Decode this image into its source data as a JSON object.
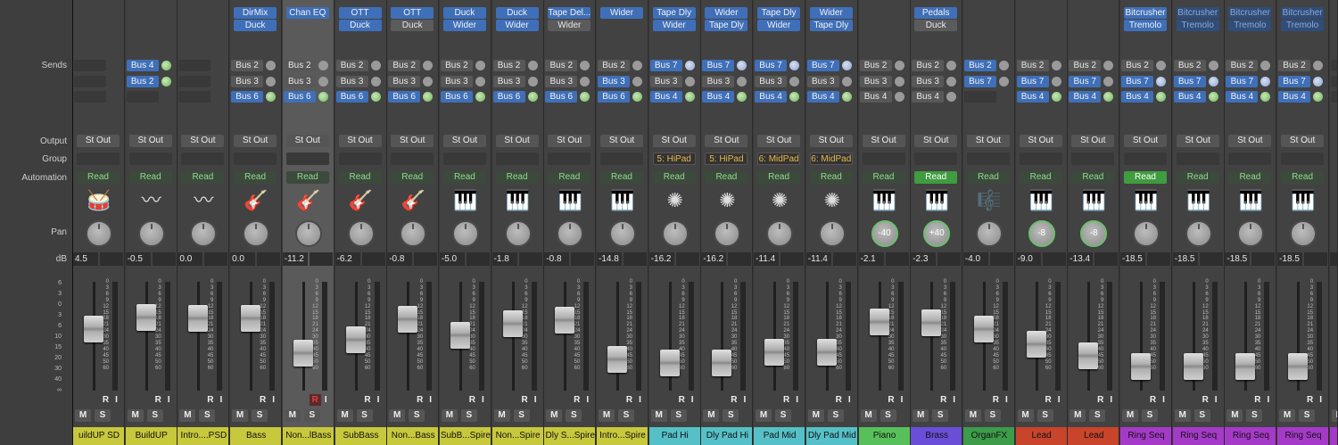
{
  "row_labels": {
    "sends": "Sends",
    "output": "Output",
    "group": "Group",
    "automation": "Automation",
    "pan": "Pan",
    "db": "dB"
  },
  "fader_scale": [
    "0",
    "3",
    "6",
    "9",
    "12",
    "15",
    "18",
    "21",
    "24",
    "30",
    "35",
    "40",
    "45",
    "50",
    "60"
  ],
  "left_scale": [
    "6",
    "3",
    "0",
    "3",
    "6",
    "10",
    "15",
    "20",
    "30",
    "40",
    "∞"
  ],
  "buttons": {
    "r": "R",
    "i": "I",
    "m": "M",
    "s": "S"
  },
  "colors": {
    "yellow": "#c8c83c",
    "cyan": "#56c0c8",
    "green": "#58c05a",
    "purple": "#6a4ed8",
    "dgreen": "#3c9c4a",
    "red": "#c8442a",
    "violet": "#a63ac8"
  },
  "strips": [
    {
      "name": "uildUP SD",
      "color": "yellow",
      "inserts": [],
      "sends": [
        {
          "t": "empty"
        },
        {
          "t": "empty"
        },
        {
          "t": "empty"
        }
      ],
      "output": "St Out",
      "group": "",
      "automation": "Read",
      "icon": "drums-icon",
      "glyph": "🥁",
      "pan": "",
      "pan_green": false,
      "db": "4.5",
      "fader": 0.62,
      "r_red": false
    },
    {
      "name": "BuildUP",
      "color": "yellow",
      "inserts": [],
      "sends": [
        {
          "label": "Bus 4",
          "t": "blue",
          "k": "g"
        },
        {
          "label": "Bus 2",
          "t": "blue",
          "k": "g"
        },
        {
          "t": "empty"
        }
      ],
      "output": "St Out",
      "group": "",
      "automation": "Read",
      "icon": "waveform-icon",
      "glyph": "〰",
      "pan": "",
      "pan_green": false,
      "db": "-0.5",
      "fader": 0.75,
      "r_red": false
    },
    {
      "name": "Intro....PSD",
      "color": "yellow",
      "inserts": [],
      "sends": [
        {
          "t": "empty"
        },
        {
          "t": "empty"
        },
        {
          "t": "empty"
        }
      ],
      "output": "St Out",
      "group": "",
      "automation": "Read",
      "icon": "waveform-icon",
      "glyph": "〰",
      "pan": "",
      "pan_green": false,
      "db": "0.0",
      "fader": 0.74,
      "r_red": false
    },
    {
      "name": "Bass",
      "color": "yellow",
      "inserts": [
        {
          "label": "DirMix",
          "t": "blue"
        },
        {
          "label": "Duck",
          "t": "blue"
        }
      ],
      "sends": [
        {
          "label": "Bus 2",
          "t": "gray"
        },
        {
          "label": "Bus 3",
          "t": "gray"
        },
        {
          "label": "Bus 6",
          "t": "blue",
          "k": "g"
        }
      ],
      "output": "St Out",
      "group": "",
      "automation": "Read",
      "icon": "bass-guitar-icon",
      "glyph": "🎸",
      "pan": "",
      "pan_green": false,
      "db": "0.0",
      "fader": 0.74,
      "r_red": false
    },
    {
      "name": "Non...lBass",
      "color": "yellow",
      "sel": true,
      "inserts": [
        {
          "label": "Chan EQ",
          "t": "blue"
        }
      ],
      "sends": [
        {
          "label": "Bus 2",
          "t": "gray"
        },
        {
          "label": "Bus 3",
          "t": "gray"
        },
        {
          "label": "Bus 6",
          "t": "blue",
          "k": "g"
        }
      ],
      "output": "St Out",
      "group": "",
      "automation": "Read",
      "icon": "bass-guitar-icon",
      "glyph": "🎸",
      "pan": "",
      "pan_green": false,
      "db": "-11.2",
      "fader": 0.35,
      "r_red": true
    },
    {
      "name": "SubBass",
      "color": "yellow",
      "inserts": [
        {
          "label": "OTT",
          "t": "blue"
        },
        {
          "label": "Duck",
          "t": "blue"
        }
      ],
      "sends": [
        {
          "label": "Bus 2",
          "t": "gray"
        },
        {
          "label": "Bus 3",
          "t": "gray"
        },
        {
          "label": "Bus 6",
          "t": "blue",
          "k": "g"
        }
      ],
      "output": "St Out",
      "group": "",
      "automation": "Read",
      "icon": "bass-guitar-icon",
      "glyph": "🎸",
      "pan": "",
      "pan_green": false,
      "db": "-6.2",
      "fader": 0.5,
      "r_red": false
    },
    {
      "name": "Non...Bass",
      "color": "yellow",
      "inserts": [
        {
          "label": "OTT",
          "t": "blue"
        },
        {
          "label": "Duck",
          "t": "gray"
        }
      ],
      "sends": [
        {
          "label": "Bus 2",
          "t": "gray"
        },
        {
          "label": "Bus 3",
          "t": "gray"
        },
        {
          "label": "Bus 6",
          "t": "blue",
          "k": "g"
        }
      ],
      "output": "St Out",
      "group": "",
      "automation": "Read",
      "icon": "bass-guitar-icon",
      "glyph": "🎸",
      "pan": "",
      "pan_green": false,
      "db": "-0.8",
      "fader": 0.73,
      "r_red": false
    },
    {
      "name": "SubB...Spire",
      "color": "yellow",
      "inserts": [
        {
          "label": "Duck",
          "t": "blue"
        },
        {
          "label": "Wider",
          "t": "blue"
        }
      ],
      "sends": [
        {
          "label": "Bus 2",
          "t": "gray"
        },
        {
          "label": "Bus 3",
          "t": "gray"
        },
        {
          "label": "Bus 6",
          "t": "blue",
          "k": "g"
        }
      ],
      "output": "St Out",
      "group": "",
      "automation": "Read",
      "icon": "keyboard-icon",
      "glyph": "🎹",
      "pan": "",
      "pan_green": false,
      "db": "-5.0",
      "fader": 0.55,
      "r_red": false
    },
    {
      "name": "Non...Spire",
      "color": "yellow",
      "inserts": [
        {
          "label": "Duck",
          "t": "blue"
        },
        {
          "label": "Wider",
          "t": "blue"
        }
      ],
      "sends": [
        {
          "label": "Bus 2",
          "t": "gray"
        },
        {
          "label": "Bus 3",
          "t": "gray"
        },
        {
          "label": "Bus 6",
          "t": "blue",
          "k": "g"
        }
      ],
      "output": "St Out",
      "group": "",
      "automation": "Read",
      "icon": "keyboard-icon",
      "glyph": "🎹",
      "pan": "",
      "pan_green": false,
      "db": "-1.8",
      "fader": 0.68,
      "r_red": false
    },
    {
      "name": "Dly S...Spire",
      "color": "yellow",
      "inserts": [
        {
          "label": "Tape Del...",
          "t": "blue"
        },
        {
          "label": "Wider",
          "t": "gray"
        }
      ],
      "sends": [
        {
          "label": "Bus 2",
          "t": "gray"
        },
        {
          "label": "Bus 3",
          "t": "gray"
        },
        {
          "label": "Bus 6",
          "t": "blue",
          "k": "g"
        }
      ],
      "output": "St Out",
      "group": "",
      "automation": "Read",
      "icon": "keyboard-icon",
      "glyph": "🎹",
      "pan": "",
      "pan_green": false,
      "db": "-0.8",
      "fader": 0.72,
      "r_red": false
    },
    {
      "name": "Intro...Spire",
      "color": "yellow",
      "inserts": [
        {
          "label": "Wider",
          "t": "blue"
        }
      ],
      "sends": [
        {
          "label": "Bus 2",
          "t": "gray"
        },
        {
          "label": "Bus 3",
          "t": "blue"
        },
        {
          "label": "Bus 6",
          "t": "blue",
          "k": "g"
        }
      ],
      "output": "St Out",
      "group": "",
      "automation": "Read",
      "icon": "keyboard-icon",
      "glyph": "🎹",
      "pan": "",
      "pan_green": false,
      "db": "-14.8",
      "fader": 0.28,
      "r_red": false
    },
    {
      "name": "Pad Hi",
      "color": "cyan",
      "inserts": [
        {
          "label": "Tape Dly",
          "t": "blue"
        },
        {
          "label": "Wider",
          "t": "blue"
        }
      ],
      "sends": [
        {
          "label": "Bus 7",
          "t": "blue",
          "k": "b"
        },
        {
          "label": "Bus 3",
          "t": "gray"
        },
        {
          "label": "Bus 4",
          "t": "blue",
          "k": "g"
        }
      ],
      "output": "St Out",
      "group": "5: HiPad",
      "automation": "Read",
      "icon": "sparkle-icon",
      "glyph": "✺",
      "pan": "",
      "pan_green": false,
      "db": "-16.2",
      "fader": 0.24,
      "r_red": false
    },
    {
      "name": "Dly Pad Hi",
      "color": "cyan",
      "inserts": [
        {
          "label": "Wider",
          "t": "blue"
        },
        {
          "label": "Tape Dly",
          "t": "blue"
        }
      ],
      "sends": [
        {
          "label": "Bus 7",
          "t": "blue",
          "k": "b"
        },
        {
          "label": "Bus 3",
          "t": "gray"
        },
        {
          "label": "Bus 4",
          "t": "blue",
          "k": "g"
        }
      ],
      "output": "St Out",
      "group": "5: HiPad",
      "automation": "Read",
      "icon": "sparkle-icon",
      "glyph": "✺",
      "pan": "",
      "pan_green": false,
      "db": "-16.2",
      "fader": 0.24,
      "r_red": false
    },
    {
      "name": "Pad Mid",
      "color": "cyan",
      "inserts": [
        {
          "label": "Tape Dly",
          "t": "blue"
        },
        {
          "label": "Wider",
          "t": "blue"
        }
      ],
      "sends": [
        {
          "label": "Bus 7",
          "t": "blue",
          "k": "b"
        },
        {
          "label": "Bus 3",
          "t": "gray"
        },
        {
          "label": "Bus 4",
          "t": "blue",
          "k": "g"
        }
      ],
      "output": "St Out",
      "group": "6: MidPad",
      "automation": "Read",
      "icon": "sparkle-icon",
      "glyph": "✺",
      "pan": "",
      "pan_green": false,
      "db": "-11.4",
      "fader": 0.36,
      "r_red": false
    },
    {
      "name": "Dly Pad Mid",
      "color": "cyan",
      "inserts": [
        {
          "label": "Wider",
          "t": "blue"
        },
        {
          "label": "Tape Dly",
          "t": "blue"
        }
      ],
      "sends": [
        {
          "label": "Bus 7",
          "t": "blue",
          "k": "b"
        },
        {
          "label": "Bus 3",
          "t": "gray"
        },
        {
          "label": "Bus 4",
          "t": "blue",
          "k": "g"
        }
      ],
      "output": "St Out",
      "group": "6: MidPad",
      "automation": "Read",
      "icon": "sparkle-icon",
      "glyph": "✺",
      "pan": "",
      "pan_green": false,
      "db": "-11.4",
      "fader": 0.36,
      "r_red": false
    },
    {
      "name": "Piano",
      "color": "green",
      "inserts": [],
      "sends": [
        {
          "label": "Bus 2",
          "t": "gray"
        },
        {
          "label": "Bus 3",
          "t": "gray"
        },
        {
          "label": "Bus 4",
          "t": "gray"
        }
      ],
      "output": "St Out",
      "group": "",
      "automation": "Read",
      "icon": "piano-icon",
      "glyph": "🎹",
      "pan": "-40",
      "pan_green": true,
      "db": "-2.1",
      "fader": 0.7,
      "r_red": false
    },
    {
      "name": "Brass",
      "color": "purple",
      "inserts": [
        {
          "label": "Pedals",
          "t": "blue"
        },
        {
          "label": "Duck",
          "t": "gray"
        }
      ],
      "sends": [
        {
          "label": "Bus 2",
          "t": "gray"
        },
        {
          "label": "Bus 3",
          "t": "gray"
        },
        {
          "label": "Bus 4",
          "t": "gray"
        }
      ],
      "output": "St Out",
      "group": "",
      "automation": "Read",
      "automation_active": true,
      "icon": "keyboard-icon",
      "glyph": "🎹",
      "pan": "+40",
      "pan_green": true,
      "db": "-2.3",
      "fader": 0.69,
      "r_red": false
    },
    {
      "name": "OrganFX",
      "color": "dgreen",
      "inserts": [],
      "sends": [
        {
          "label": "Bus 2",
          "t": "blue"
        },
        {
          "label": "Bus 7",
          "t": "blue"
        },
        {
          "t": "empty"
        }
      ],
      "output": "St Out",
      "group": "",
      "automation": "Read",
      "icon": "organ-icon",
      "glyph": "🎼",
      "pan": "",
      "pan_green": false,
      "db": "-4.0",
      "fader": 0.62,
      "r_red": false
    },
    {
      "name": "Lead",
      "color": "red",
      "inserts": [],
      "sends": [
        {
          "label": "Bus 2",
          "t": "gray"
        },
        {
          "label": "Bus 7",
          "t": "blue"
        },
        {
          "label": "Bus 4",
          "t": "blue",
          "k": "g"
        }
      ],
      "output": "St Out",
      "group": "",
      "automation": "Read",
      "icon": "synth-icon",
      "glyph": "🎹",
      "pan": "-8",
      "pan_green": true,
      "db": "-9.0",
      "fader": 0.45,
      "r_red": false
    },
    {
      "name": "Lead",
      "color": "red",
      "inserts": [],
      "sends": [
        {
          "label": "Bus 2",
          "t": "gray"
        },
        {
          "label": "Bus 7",
          "t": "blue"
        },
        {
          "label": "Bus 4",
          "t": "blue",
          "k": "g"
        }
      ],
      "output": "St Out",
      "group": "",
      "automation": "Read",
      "icon": "synth-icon",
      "glyph": "🎹",
      "pan": "-8",
      "pan_green": true,
      "db": "-13.4",
      "fader": 0.32,
      "r_red": false
    },
    {
      "name": "Ring Seq",
      "color": "violet",
      "inserts": [
        {
          "label": "Bitcrusher",
          "t": "blue"
        },
        {
          "label": "Tremolo",
          "t": "blue"
        }
      ],
      "sends": [
        {
          "label": "Bus 2",
          "t": "gray"
        },
        {
          "label": "Bus 7",
          "t": "blue",
          "k": "b"
        },
        {
          "label": "Bus 4",
          "t": "blue",
          "k": "g"
        }
      ],
      "output": "St Out",
      "group": "",
      "automation": "Read",
      "automation_active": true,
      "icon": "keyboard-icon",
      "glyph": "🎹",
      "pan": "",
      "pan_green": false,
      "db": "-18.5",
      "fader": 0.2,
      "r_red": false
    },
    {
      "name": "Ring Seq",
      "color": "violet",
      "inserts": [
        {
          "label": "Bitcrusher",
          "t": "dim"
        },
        {
          "label": "Tremolo",
          "t": "dim"
        }
      ],
      "sends": [
        {
          "label": "Bus 2",
          "t": "gray"
        },
        {
          "label": "Bus 7",
          "t": "blue",
          "k": "b"
        },
        {
          "label": "Bus 4",
          "t": "blue",
          "k": "g"
        }
      ],
      "output": "St Out",
      "group": "",
      "automation": "Read",
      "icon": "keyboard-icon",
      "glyph": "🎹",
      "pan": "",
      "pan_green": false,
      "db": "-18.5",
      "fader": 0.2,
      "r_red": false
    },
    {
      "name": "Ring Seq",
      "color": "violet",
      "inserts": [
        {
          "label": "Bitcrusher",
          "t": "dim"
        },
        {
          "label": "Tremolo",
          "t": "dim"
        }
      ],
      "sends": [
        {
          "label": "Bus 2",
          "t": "gray"
        },
        {
          "label": "Bus 7",
          "t": "blue",
          "k": "b"
        },
        {
          "label": "Bus 4",
          "t": "blue",
          "k": "g"
        }
      ],
      "output": "St Out",
      "group": "",
      "automation": "Read",
      "icon": "keyboard-icon",
      "glyph": "🎹",
      "pan": "",
      "pan_green": false,
      "db": "-18.5",
      "fader": 0.2,
      "r_red": false
    },
    {
      "name": "Ring Seq",
      "color": "violet",
      "inserts": [
        {
          "label": "Bitcrusher",
          "t": "dim"
        },
        {
          "label": "Tremolo",
          "t": "dim"
        }
      ],
      "sends": [
        {
          "label": "Bus 2",
          "t": "gray"
        },
        {
          "label": "Bus 7",
          "t": "blue",
          "k": "b"
        },
        {
          "label": "Bus 4",
          "t": "blue",
          "k": "g"
        }
      ],
      "output": "St Out",
      "group": "",
      "automation": "Read",
      "icon": "keyboard-icon",
      "glyph": "🎹",
      "pan": "",
      "pan_green": false,
      "db": "-18.5",
      "fader": 0.2,
      "r_red": false
    },
    {
      "name": "Ri",
      "color": "violet",
      "inserts": [],
      "sends": [
        {
          "t": "empty"
        },
        {
          "t": "empty"
        },
        {
          "t": "empty"
        }
      ],
      "output": "",
      "group": "",
      "automation": "",
      "icon": "keyboard-icon",
      "glyph": "",
      "pan": "",
      "pan_green": false,
      "db": "",
      "fader": 0.2,
      "r_red": false
    }
  ]
}
